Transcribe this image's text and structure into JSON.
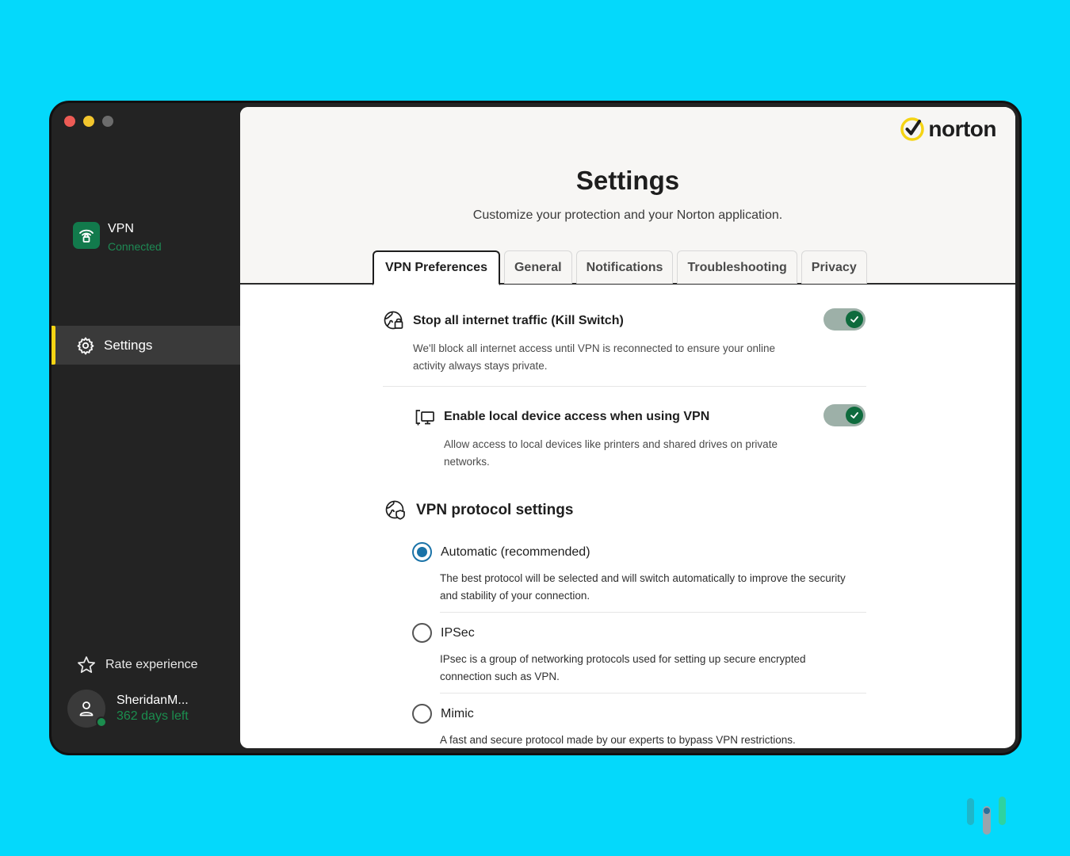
{
  "window": {
    "controls": [
      "close",
      "minimize",
      "zoom"
    ]
  },
  "sidebar": {
    "vpn": {
      "label": "VPN",
      "status": "Connected",
      "icon": "wifi-lock-icon"
    },
    "nav": [
      {
        "label": "Settings",
        "icon": "gear-icon",
        "active": true
      }
    ],
    "rate_label": "Rate experience",
    "account": {
      "name": "SheridanM...",
      "days_left": "362 days left"
    }
  },
  "brand": {
    "logo_text": "norton"
  },
  "header": {
    "title": "Settings",
    "subtitle": "Customize your protection and your Norton application."
  },
  "tabs": [
    {
      "label": "VPN Preferences",
      "active": true
    },
    {
      "label": "General",
      "active": false
    },
    {
      "label": "Notifications",
      "active": false
    },
    {
      "label": "Troubleshooting",
      "active": false
    },
    {
      "label": "Privacy",
      "active": false
    }
  ],
  "settings": {
    "kill_switch": {
      "title": "Stop all internet traffic (Kill Switch)",
      "description": "We'll block all internet access until VPN is reconnected to ensure your online activity always stays private.",
      "enabled": true
    },
    "local_access": {
      "title": "Enable local device access when using VPN",
      "description": "Allow access to local devices like printers and shared drives on private networks.",
      "enabled": true
    }
  },
  "protocol": {
    "title": "VPN protocol settings",
    "options": [
      {
        "label": "Automatic (recommended)",
        "description": "The best protocol will be selected and will switch automatically to improve the security and stability of your connection.",
        "selected": true
      },
      {
        "label": "IPSec",
        "description": "IPsec is a group of networking protocols used for setting up secure encrypted connection such as VPN.",
        "selected": false
      },
      {
        "label": "Mimic",
        "description": "A fast and secure protocol made by our experts to bypass VPN restrictions.",
        "selected": false
      }
    ]
  },
  "colors": {
    "background": "#04d9fb",
    "sidebar": "#232323",
    "accent_green": "#0e6b3d",
    "active_indicator": "#f5d414",
    "radio_blue": "#1a73a8",
    "logo_yellow": "#f5d414"
  }
}
